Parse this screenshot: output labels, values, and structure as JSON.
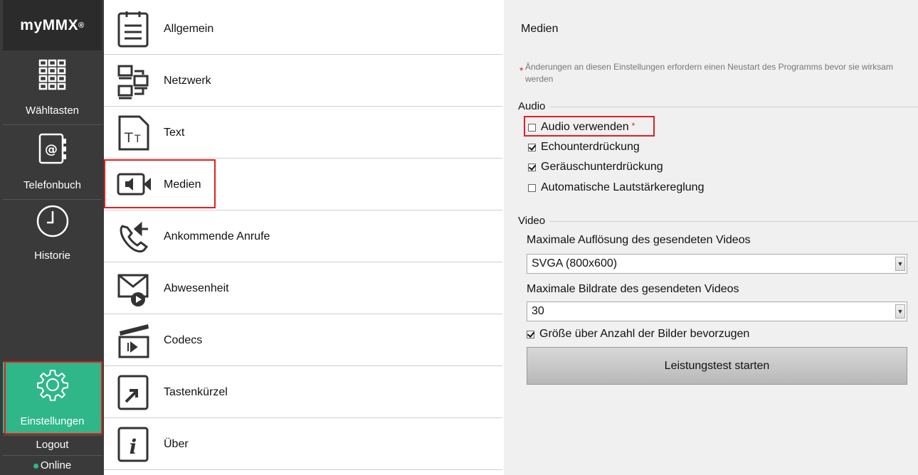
{
  "app": {
    "logo": "myMMX",
    "logo_mark": "®"
  },
  "rail": {
    "items": [
      {
        "label": "Wähltasten",
        "icon": "dialpad-icon"
      },
      {
        "label": "Telefonbuch",
        "icon": "phonebook-icon"
      },
      {
        "label": "Historie",
        "icon": "clock-icon"
      },
      {
        "label": "Einstellungen",
        "icon": "gear-icon",
        "active": true
      }
    ],
    "logout": "Logout",
    "status": "Online",
    "status_color": "#2fb789",
    "active_color": "#2fb789"
  },
  "menu": {
    "items": [
      {
        "label": "Allgemein",
        "icon": "notepad-icon"
      },
      {
        "label": "Netzwerk",
        "icon": "network-icon"
      },
      {
        "label": "Text",
        "icon": "text-icon"
      },
      {
        "label": "Medien",
        "icon": "media-icon",
        "selected": true
      },
      {
        "label": "Ankommende Anrufe",
        "icon": "incoming-call-icon"
      },
      {
        "label": "Abwesenheit",
        "icon": "absence-icon"
      },
      {
        "label": "Codecs",
        "icon": "clapper-icon"
      },
      {
        "label": "Tastenkürzel",
        "icon": "shortcut-icon"
      },
      {
        "label": "Über",
        "icon": "info-icon"
      }
    ]
  },
  "panel": {
    "title": "Medien",
    "note": "Änderungen an diesen Einstellungen erfordern einen Neustart des Programms bevor sie wirksam werden",
    "note_marker": "*",
    "audio": {
      "title": "Audio",
      "options": [
        {
          "label": "Audio verwenden",
          "checked": false,
          "required": "*"
        },
        {
          "label": "Echounterdrückung",
          "checked": true
        },
        {
          "label": "Geräuschunterdrückung",
          "checked": true
        },
        {
          "label": "Automatische Lautstärkereglung",
          "checked": false
        }
      ]
    },
    "video": {
      "title": "Video",
      "resolution_label": "Maximale Auflösung des gesendeten Videos",
      "resolution_value": "SVGA (800x600)",
      "framerate_label": "Maximale Bildrate des gesendeten Videos",
      "framerate_value": "30",
      "prefer_size_label": "Größe über Anzahl der Bilder bevorzugen",
      "prefer_size_checked": true,
      "test_button": "Leistungstest starten"
    }
  },
  "highlight_color": "#e02020"
}
